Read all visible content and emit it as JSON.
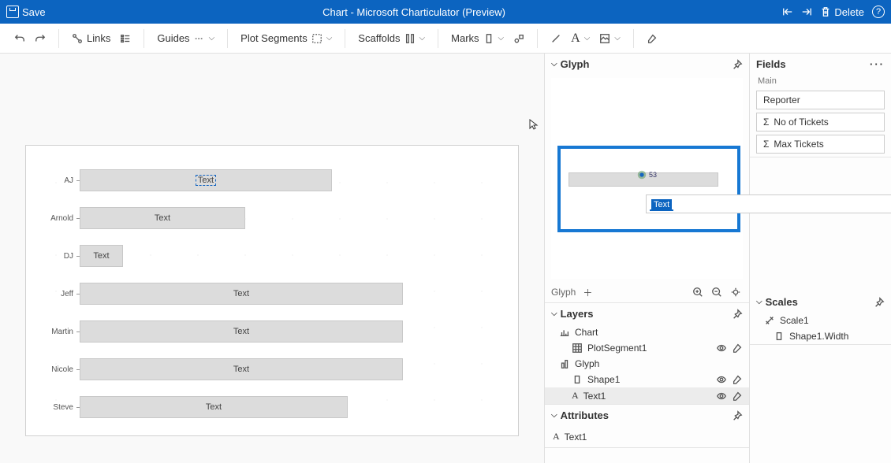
{
  "titlebar": {
    "save": "Save",
    "title": "Chart - Microsoft Charticulator (Preview)",
    "delete": "Delete"
  },
  "toolbar": {
    "links": "Links",
    "guides": "Guides",
    "plot_segments": "Plot Segments",
    "scaffolds": "Scaffolds",
    "marks": "Marks"
  },
  "panels": {
    "glyph": {
      "title": "Glyph",
      "footer_label": "Glyph",
      "editor_value": "Text",
      "badge": "53"
    },
    "layers": {
      "title": "Layers",
      "chart": "Chart",
      "plotsegment": "PlotSegment1",
      "glyph": "Glyph",
      "shape": "Shape1",
      "text": "Text1"
    },
    "attributes": {
      "title": "Attributes",
      "current": "Text1"
    },
    "fields": {
      "title": "Fields",
      "main": "Main",
      "items": [
        "Reporter",
        "No of Tickets",
        "Max Tickets"
      ]
    },
    "scales": {
      "title": "Scales",
      "scale": "Scale1",
      "prop": "Shape1.Width"
    }
  },
  "chart_data": {
    "type": "bar",
    "categories": [
      "AJ",
      "Arnold",
      "DJ",
      "Jeff",
      "Martin",
      "Nicole",
      "Steve"
    ],
    "values": [
      64,
      42,
      11,
      82,
      82,
      82,
      68
    ],
    "bar_label": "Text",
    "xlabel": "",
    "ylabel": "",
    "ylim": [
      0,
      100
    ]
  }
}
